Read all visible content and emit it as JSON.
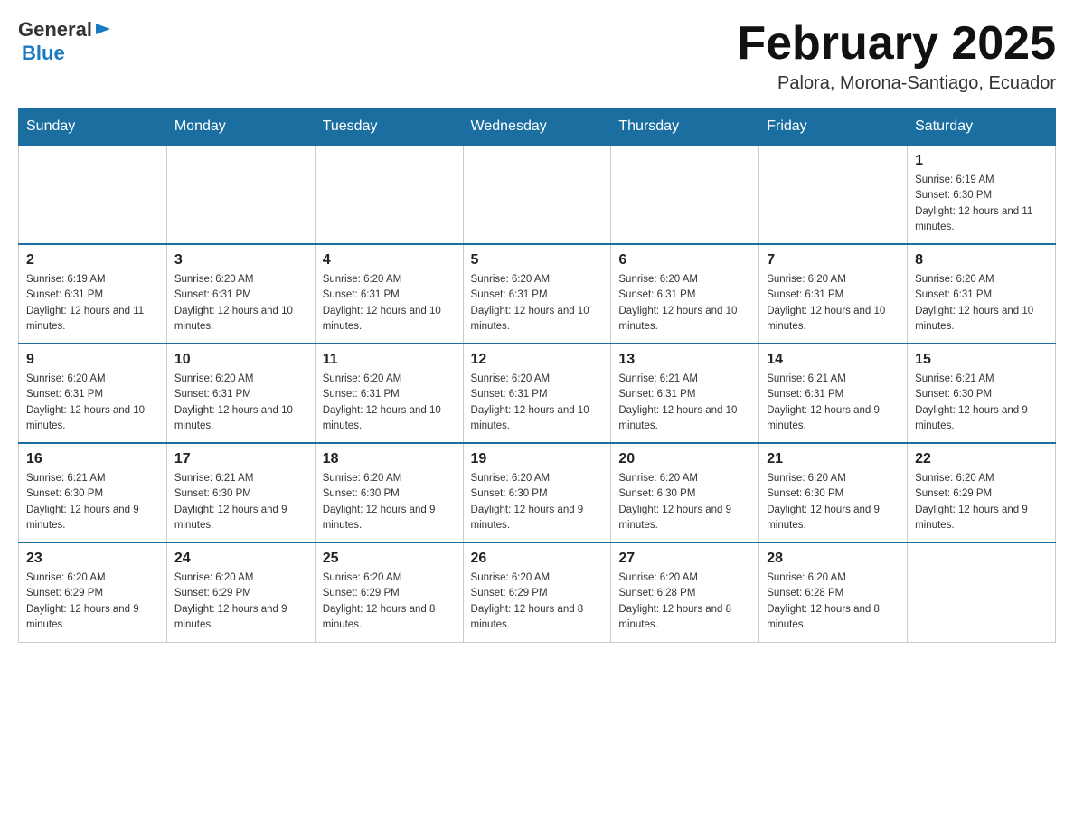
{
  "header": {
    "logo": {
      "general": "General",
      "blue": "Blue",
      "alt": "GeneralBlue Logo"
    },
    "title": "February 2025",
    "location": "Palora, Morona-Santiago, Ecuador"
  },
  "days_of_week": [
    "Sunday",
    "Monday",
    "Tuesday",
    "Wednesday",
    "Thursday",
    "Friday",
    "Saturday"
  ],
  "weeks": [
    [
      {
        "day": "",
        "info": ""
      },
      {
        "day": "",
        "info": ""
      },
      {
        "day": "",
        "info": ""
      },
      {
        "day": "",
        "info": ""
      },
      {
        "day": "",
        "info": ""
      },
      {
        "day": "",
        "info": ""
      },
      {
        "day": "1",
        "info": "Sunrise: 6:19 AM\nSunset: 6:30 PM\nDaylight: 12 hours and 11 minutes."
      }
    ],
    [
      {
        "day": "2",
        "info": "Sunrise: 6:19 AM\nSunset: 6:31 PM\nDaylight: 12 hours and 11 minutes."
      },
      {
        "day": "3",
        "info": "Sunrise: 6:20 AM\nSunset: 6:31 PM\nDaylight: 12 hours and 10 minutes."
      },
      {
        "day": "4",
        "info": "Sunrise: 6:20 AM\nSunset: 6:31 PM\nDaylight: 12 hours and 10 minutes."
      },
      {
        "day": "5",
        "info": "Sunrise: 6:20 AM\nSunset: 6:31 PM\nDaylight: 12 hours and 10 minutes."
      },
      {
        "day": "6",
        "info": "Sunrise: 6:20 AM\nSunset: 6:31 PM\nDaylight: 12 hours and 10 minutes."
      },
      {
        "day": "7",
        "info": "Sunrise: 6:20 AM\nSunset: 6:31 PM\nDaylight: 12 hours and 10 minutes."
      },
      {
        "day": "8",
        "info": "Sunrise: 6:20 AM\nSunset: 6:31 PM\nDaylight: 12 hours and 10 minutes."
      }
    ],
    [
      {
        "day": "9",
        "info": "Sunrise: 6:20 AM\nSunset: 6:31 PM\nDaylight: 12 hours and 10 minutes."
      },
      {
        "day": "10",
        "info": "Sunrise: 6:20 AM\nSunset: 6:31 PM\nDaylight: 12 hours and 10 minutes."
      },
      {
        "day": "11",
        "info": "Sunrise: 6:20 AM\nSunset: 6:31 PM\nDaylight: 12 hours and 10 minutes."
      },
      {
        "day": "12",
        "info": "Sunrise: 6:20 AM\nSunset: 6:31 PM\nDaylight: 12 hours and 10 minutes."
      },
      {
        "day": "13",
        "info": "Sunrise: 6:21 AM\nSunset: 6:31 PM\nDaylight: 12 hours and 10 minutes."
      },
      {
        "day": "14",
        "info": "Sunrise: 6:21 AM\nSunset: 6:31 PM\nDaylight: 12 hours and 9 minutes."
      },
      {
        "day": "15",
        "info": "Sunrise: 6:21 AM\nSunset: 6:30 PM\nDaylight: 12 hours and 9 minutes."
      }
    ],
    [
      {
        "day": "16",
        "info": "Sunrise: 6:21 AM\nSunset: 6:30 PM\nDaylight: 12 hours and 9 minutes."
      },
      {
        "day": "17",
        "info": "Sunrise: 6:21 AM\nSunset: 6:30 PM\nDaylight: 12 hours and 9 minutes."
      },
      {
        "day": "18",
        "info": "Sunrise: 6:20 AM\nSunset: 6:30 PM\nDaylight: 12 hours and 9 minutes."
      },
      {
        "day": "19",
        "info": "Sunrise: 6:20 AM\nSunset: 6:30 PM\nDaylight: 12 hours and 9 minutes."
      },
      {
        "day": "20",
        "info": "Sunrise: 6:20 AM\nSunset: 6:30 PM\nDaylight: 12 hours and 9 minutes."
      },
      {
        "day": "21",
        "info": "Sunrise: 6:20 AM\nSunset: 6:30 PM\nDaylight: 12 hours and 9 minutes."
      },
      {
        "day": "22",
        "info": "Sunrise: 6:20 AM\nSunset: 6:29 PM\nDaylight: 12 hours and 9 minutes."
      }
    ],
    [
      {
        "day": "23",
        "info": "Sunrise: 6:20 AM\nSunset: 6:29 PM\nDaylight: 12 hours and 9 minutes."
      },
      {
        "day": "24",
        "info": "Sunrise: 6:20 AM\nSunset: 6:29 PM\nDaylight: 12 hours and 9 minutes."
      },
      {
        "day": "25",
        "info": "Sunrise: 6:20 AM\nSunset: 6:29 PM\nDaylight: 12 hours and 8 minutes."
      },
      {
        "day": "26",
        "info": "Sunrise: 6:20 AM\nSunset: 6:29 PM\nDaylight: 12 hours and 8 minutes."
      },
      {
        "day": "27",
        "info": "Sunrise: 6:20 AM\nSunset: 6:28 PM\nDaylight: 12 hours and 8 minutes."
      },
      {
        "day": "28",
        "info": "Sunrise: 6:20 AM\nSunset: 6:28 PM\nDaylight: 12 hours and 8 minutes."
      },
      {
        "day": "",
        "info": ""
      }
    ]
  ]
}
